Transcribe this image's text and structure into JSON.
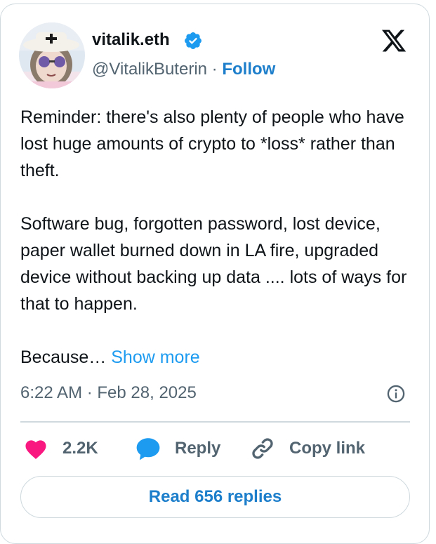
{
  "author": {
    "display_name": "vitalik.eth",
    "handle": "@VitalikButerin",
    "separator": "·",
    "follow_label": "Follow"
  },
  "tweet": {
    "paragraphs": [
      "Reminder: there's also plenty of people who have lost huge amounts of crypto to *loss* rather than theft.",
      "Software bug, forgotten password, lost device, paper wallet burned down in LA fire, upgraded device without backing up data .... lots of ways for that to happen."
    ],
    "truncated_text": "Because…",
    "show_more_label": "Show more",
    "timestamp": "6:22 AM · Feb 28, 2025"
  },
  "actions": {
    "like_count": "2.2K",
    "reply_label": "Reply",
    "copy_link_label": "Copy link"
  },
  "read_replies_label": "Read 656 replies",
  "colors": {
    "accent": "#1d9bf0",
    "heart": "#f91880",
    "reply_bubble": "#1d9bf0",
    "border": "#cfd9de",
    "muted": "#536471"
  },
  "icons": [
    "verified-badge-icon",
    "x-logo-icon",
    "info-icon",
    "heart-icon",
    "reply-bubble-icon",
    "link-icon"
  ]
}
